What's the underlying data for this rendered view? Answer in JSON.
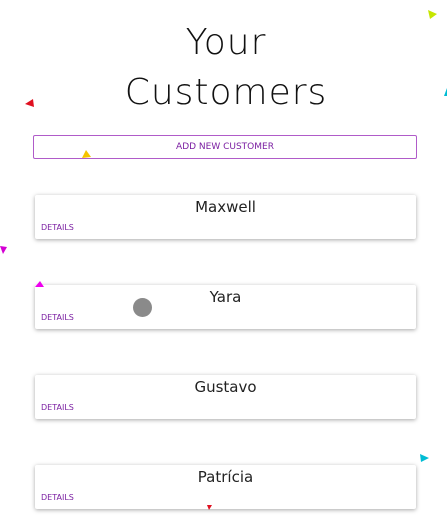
{
  "header": {
    "title_line1": "Your",
    "title_line2": "Customers"
  },
  "actions": {
    "add_label": "ADD NEW CUSTOMER"
  },
  "customers": [
    {
      "name": "Maxwell",
      "details_label": "DETAILS"
    },
    {
      "name": "Yara",
      "details_label": "DETAILS"
    },
    {
      "name": "Gustavo",
      "details_label": "DETAILS"
    },
    {
      "name": "Patrícia",
      "details_label": "DETAILS"
    }
  ],
  "colors": {
    "accent": "#7b1fa2",
    "accent_border": "#b05bc9",
    "confetti": [
      "#c6e600",
      "#e01020",
      "#00bcd4",
      "#f5c400",
      "#d400d4",
      "#ee00ee"
    ]
  }
}
